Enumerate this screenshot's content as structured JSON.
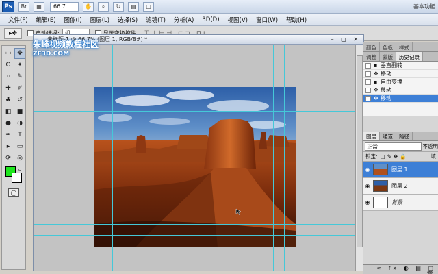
{
  "app": {
    "logo": "Ps",
    "zoom": "66.7",
    "workspace": "基本功能"
  },
  "menu": [
    "文件(F)",
    "编辑(E)",
    "图像(I)",
    "图层(L)",
    "选择(S)",
    "滤镜(T)",
    "分析(A)",
    "3D(D)",
    "视图(V)",
    "窗口(W)",
    "帮助(H)"
  ],
  "options": {
    "auto_select_label": "自动选择:",
    "auto_select_value": "组",
    "show_transform_label": "显示变换控件"
  },
  "document": {
    "title": "未标题-1 @ 66.7% (图层 1, RGB/8#) *"
  },
  "watermark": {
    "line1": "朱峰视频教程社区",
    "line2": "ZF3D.COM"
  },
  "history": {
    "tabs": [
      "颜色",
      "色板",
      "样式"
    ],
    "tabs2": [
      "调整",
      "蒙版",
      "历史记录"
    ],
    "items": [
      {
        "label": "垂直翻转",
        "selected": false
      },
      {
        "label": "移动",
        "selected": false
      },
      {
        "label": "自由变换",
        "selected": false
      },
      {
        "label": "移动",
        "selected": false
      },
      {
        "label": "移动",
        "selected": true
      }
    ]
  },
  "layers": {
    "tabs": [
      "图层",
      "通道",
      "路径"
    ],
    "blend_mode": "正常",
    "opacity_label": "不透明",
    "lock_label": "锁定:",
    "fill_label": "填",
    "items": [
      {
        "name": "图层 1",
        "selected": true
      },
      {
        "name": "图层 2",
        "selected": false
      },
      {
        "name": "背景",
        "selected": false
      }
    ]
  },
  "colors": {
    "foreground": "#1ee61e",
    "background": "#ffffff",
    "accent": "#3d7fd6",
    "guide": "#45c8d8"
  }
}
